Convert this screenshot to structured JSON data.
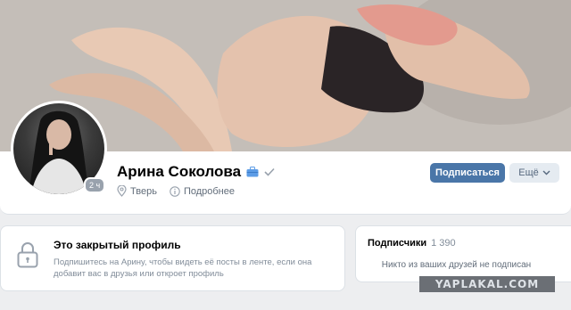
{
  "profile": {
    "name": "Арина Соколова",
    "online_badge": "2 ч",
    "city": "Тверь",
    "details_label": "Подробнее",
    "subscribe_label": "Подписаться",
    "more_label": "Ещё",
    "icons": {
      "case": "briefcase-icon",
      "verified": "checkmark-icon",
      "location": "location-pin-icon",
      "info": "info-icon",
      "more": "chevron-down-icon"
    }
  },
  "private_profile": {
    "title": "Это закрытый профиль",
    "description": "Подпишитесь на Арину, чтобы видеть её посты в ленте, если она добавит вас в друзья или откроет профиль",
    "icon": "lock-icon"
  },
  "subscribers": {
    "title": "Подписчики",
    "count": "1 390",
    "empty_text": "Никто из ваших друзей не подписан"
  },
  "watermark": "YAPLAKAL.COM",
  "colors": {
    "accent": "#4a76a8",
    "background": "#edeef0",
    "secondary_button": "#e5ebf1"
  }
}
